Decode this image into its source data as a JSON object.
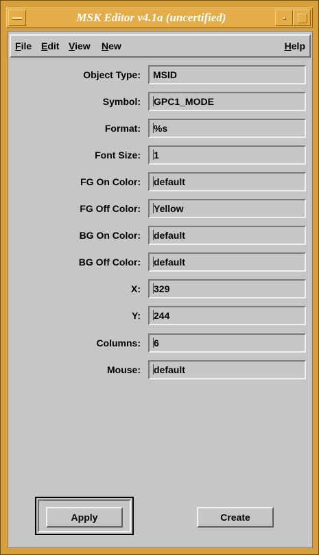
{
  "window": {
    "title": "MSK Editor v4.1a (uncertified)"
  },
  "menu": {
    "file": "F",
    "file_rest": "ile",
    "edit": "E",
    "edit_rest": "dit",
    "view": "V",
    "view_rest": "iew",
    "new": "N",
    "new_rest": "ew",
    "help": "H",
    "help_rest": "elp"
  },
  "form": {
    "fields": [
      {
        "label": "Object Type:",
        "value": "MSID"
      },
      {
        "label": "Symbol:",
        "value": "GPC1_MODE"
      },
      {
        "label": "Format:",
        "value": "%s"
      },
      {
        "label": "Font Size:",
        "value": "1"
      },
      {
        "label": "FG On Color:",
        "value": "default"
      },
      {
        "label": "FG Off Color:",
        "value": "Yellow"
      },
      {
        "label": "BG On Color:",
        "value": "default"
      },
      {
        "label": "BG Off Color:",
        "value": "default"
      },
      {
        "label": "X:",
        "value": "329"
      },
      {
        "label": "Y:",
        "value": "244"
      },
      {
        "label": "Columns:",
        "value": "6"
      },
      {
        "label": "Mouse:",
        "value": "default"
      }
    ]
  },
  "buttons": {
    "apply": "Apply",
    "create": "Create"
  },
  "colors": {
    "frame": "#d7a03c",
    "panel": "#c6c6c6",
    "title_text": "#ffffff"
  }
}
